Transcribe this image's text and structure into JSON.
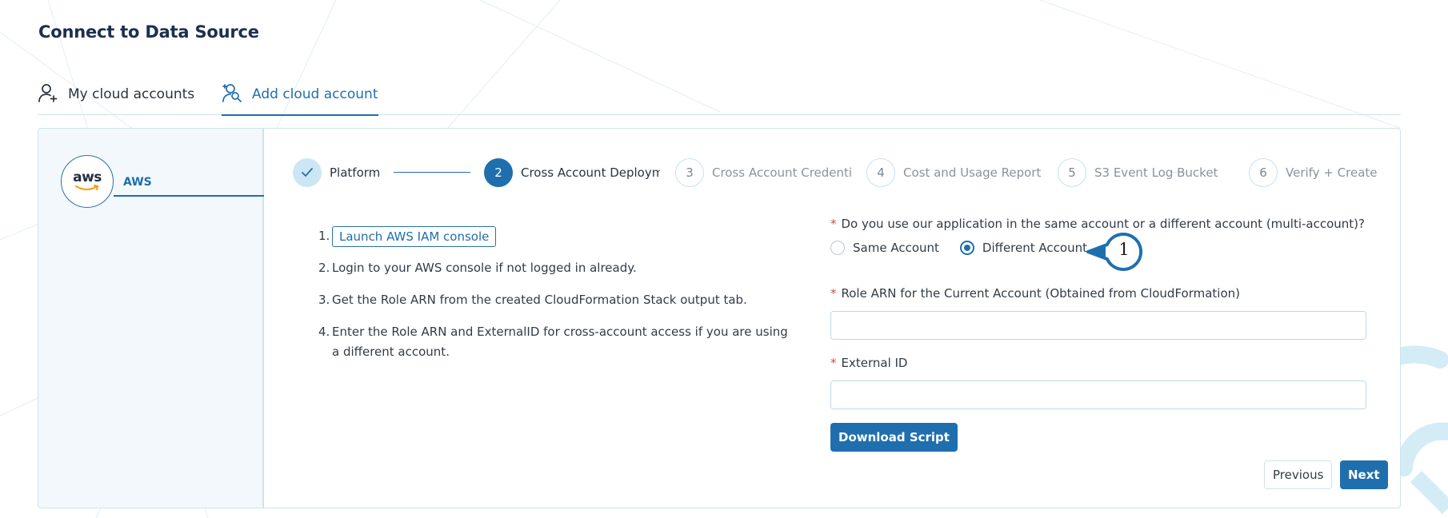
{
  "page": {
    "title": "Connect to Data Source"
  },
  "tabs": [
    {
      "label": "My cloud accounts",
      "icon": "user-icon",
      "active": false
    },
    {
      "label": "Add cloud account",
      "icon": "user-search-plus-icon",
      "active": true
    }
  ],
  "provider": {
    "logo_text": "aws",
    "name": "AWS",
    "selected": true
  },
  "stepper": {
    "steps": [
      {
        "number": "",
        "label": "Platform",
        "status": "done"
      },
      {
        "number": "2",
        "label": "Cross Account Deployment",
        "status": "active"
      },
      {
        "number": "3",
        "label": "Cross Account Credentials",
        "status": "pending"
      },
      {
        "number": "4",
        "label": "Cost and Usage Report Bucket",
        "status": "pending"
      },
      {
        "number": "5",
        "label": "S3 Event Log Bucket",
        "status": "pending"
      },
      {
        "number": "6",
        "label": "Verify + Create",
        "status": "pending"
      }
    ]
  },
  "instructions": [
    {
      "num": "1.",
      "button": "Launch AWS IAM console"
    },
    {
      "num": "2.",
      "text": "Login to your AWS console if not logged in already."
    },
    {
      "num": "3.",
      "text": "Get the Role ARN from the created CloudFormation Stack output tab."
    },
    {
      "num": "4.",
      "text": "Enter the Role ARN and ExternalID for cross-account access if you are using a different account."
    }
  ],
  "form": {
    "required_mark": "*",
    "account_question": "Do you use our application in the same account or a different account (multi-account)?",
    "account_options": [
      {
        "label": "Same Account",
        "checked": false
      },
      {
        "label": "Different Account",
        "checked": true
      }
    ],
    "role_arn_label": "Role ARN for the Current Account (Obtained from CloudFormation)",
    "role_arn_value": "",
    "external_id_label": "External ID",
    "external_id_value": "",
    "download_label": "Download Script"
  },
  "nav": {
    "previous_label": "Previous",
    "next_label": "Next"
  },
  "callout": {
    "number": "1"
  },
  "colors": {
    "primary": "#1f6fae",
    "required": "#e0453f",
    "sidebar_bg": "#f2f8fb",
    "border": "#cfe3ec"
  }
}
